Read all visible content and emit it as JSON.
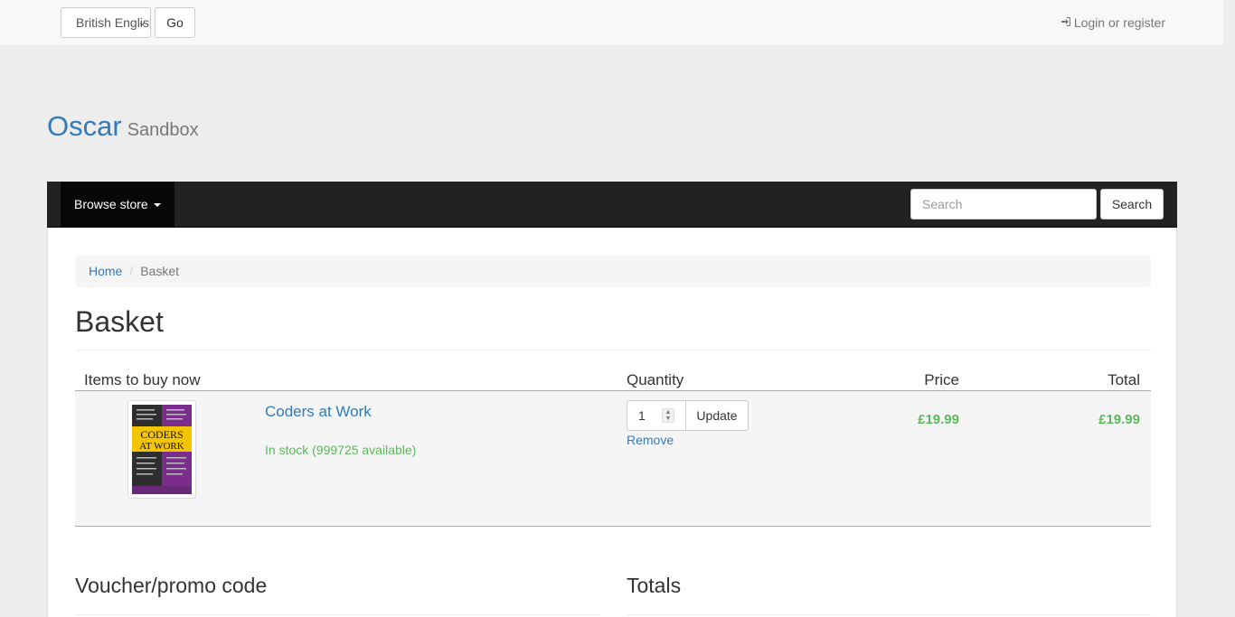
{
  "topbar": {
    "language_value": "British English",
    "go_label": "Go",
    "login_label": "Login or register"
  },
  "brand": {
    "name": "Oscar",
    "tagline": "Sandbox"
  },
  "nav": {
    "browse_label": "Browse store",
    "search_placeholder": "Search",
    "search_button": "Search"
  },
  "breadcrumb": {
    "home": "Home",
    "separator": "/",
    "current": "Basket"
  },
  "page": {
    "title": "Basket"
  },
  "basket": {
    "headers": {
      "items": "Items to buy now",
      "quantity": "Quantity",
      "price": "Price",
      "total": "Total"
    },
    "line": {
      "title": "Coders at Work",
      "stock": "In stock (999725 available)",
      "quantity": "1",
      "update_label": "Update",
      "remove_label": "Remove",
      "price": "£19.99",
      "total": "£19.99",
      "cover_text": [
        "CODERS",
        "AT WORK"
      ],
      "cover_colors": {
        "top": "#3b3b3b",
        "band": "#f5c400",
        "side": "#7b2d8e"
      }
    }
  },
  "sections": {
    "voucher": "Voucher/promo code",
    "totals": "Totals"
  },
  "colors": {
    "link": "#337ab7",
    "success": "#5cb85c",
    "navbar": "#222222"
  }
}
